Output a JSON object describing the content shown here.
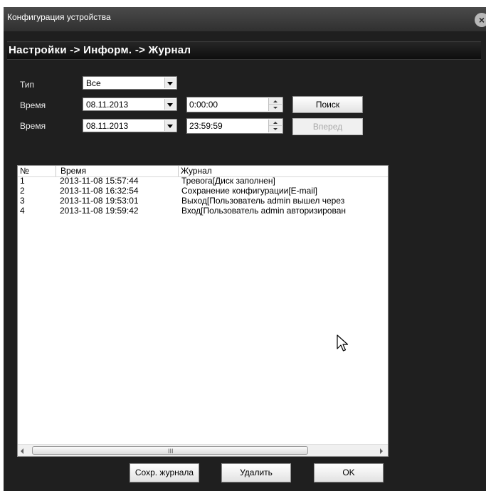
{
  "window": {
    "title": "Конфигурация устройства",
    "close_icon": "close-icon"
  },
  "header": {
    "path": "Настройки -> Информ. -> Журнал"
  },
  "filters": {
    "type_label": "Тип",
    "type_value": "Все",
    "start_label": "Время",
    "start_date": "08.11.2013",
    "start_time": "0:00:00",
    "end_label": "Время",
    "end_date": "08.11.2013",
    "end_time": "23:59:59",
    "search_button": "Поиск",
    "next_button": "Вперед"
  },
  "log": {
    "columns": [
      "№",
      "Время",
      "Журнал"
    ],
    "rows": [
      {
        "num": "1",
        "time": "2013-11-08 15:57:44",
        "text": "Тревога[Диск заполнен]"
      },
      {
        "num": "2",
        "time": "2013-11-08 16:32:54",
        "text": "Сохранение конфигурации[E-mail]"
      },
      {
        "num": "3",
        "time": "2013-11-08 19:53:01",
        "text": "Выход[Пользователь admin вышел через"
      },
      {
        "num": "4",
        "time": "2013-11-08 19:59:42",
        "text": "Вход[Пользователь admin авторизирован"
      }
    ],
    "scroll_grip": "III"
  },
  "footer": {
    "save_log_button": "Сохр. журнала",
    "delete_button": "Удалить",
    "ok_button": "OK"
  },
  "colors": {
    "window_bg": "#1f1f1f",
    "title_bar": "#3c3c3c",
    "text_light": "#e8e8e8"
  }
}
